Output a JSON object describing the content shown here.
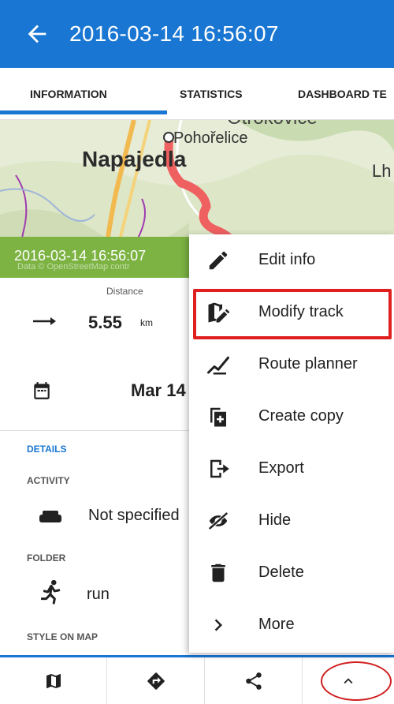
{
  "header": {
    "back_icon": "arrow-left-icon",
    "title": "2016-03-14 16:56:07"
  },
  "tabs": [
    {
      "label": "INFORMATION",
      "active": true
    },
    {
      "label": "STATISTICS",
      "active": false
    },
    {
      "label": "DASHBOARD TE",
      "active": false
    }
  ],
  "map": {
    "labels": {
      "city1": "Napajedla",
      "city2": "Pohořelice",
      "city3": "Lh",
      "city4": "Otrokovice"
    },
    "banner_date": "2016-03-14 16:56:07",
    "attribution": "Data © OpenStreetMap contr"
  },
  "stats": {
    "distance_label": "Distance",
    "distance_value": "5.55",
    "distance_unit": "km",
    "date_value": "Mar 14"
  },
  "details": {
    "section_title": "DETAILS",
    "activity_label": "ACTIVITY",
    "activity_value": "Not specified",
    "folder_label": "FOLDER",
    "folder_value": "run",
    "style_label": "STYLE ON MAP"
  },
  "menu": {
    "items": [
      {
        "label": "Edit info",
        "icon": "pencil-icon"
      },
      {
        "label": "Modify track",
        "icon": "modify-track-icon",
        "highlighted": true
      },
      {
        "label": "Route planner",
        "icon": "route-planner-icon"
      },
      {
        "label": "Create copy",
        "icon": "copy-icon"
      },
      {
        "label": "Export",
        "icon": "export-icon"
      },
      {
        "label": "Hide",
        "icon": "eye-off-icon"
      },
      {
        "label": "Delete",
        "icon": "trash-icon"
      },
      {
        "label": "More",
        "icon": "chevron-right-icon"
      }
    ]
  },
  "bottom_bar": {
    "items": [
      {
        "icon": "map-icon"
      },
      {
        "icon": "navigate-icon"
      },
      {
        "icon": "share-icon"
      },
      {
        "icon": "chevron-up-icon"
      }
    ]
  },
  "colors": {
    "primary": "#1976d2",
    "banner": "#7cb342",
    "annotation": "#e02020",
    "track": "#ef6060"
  }
}
